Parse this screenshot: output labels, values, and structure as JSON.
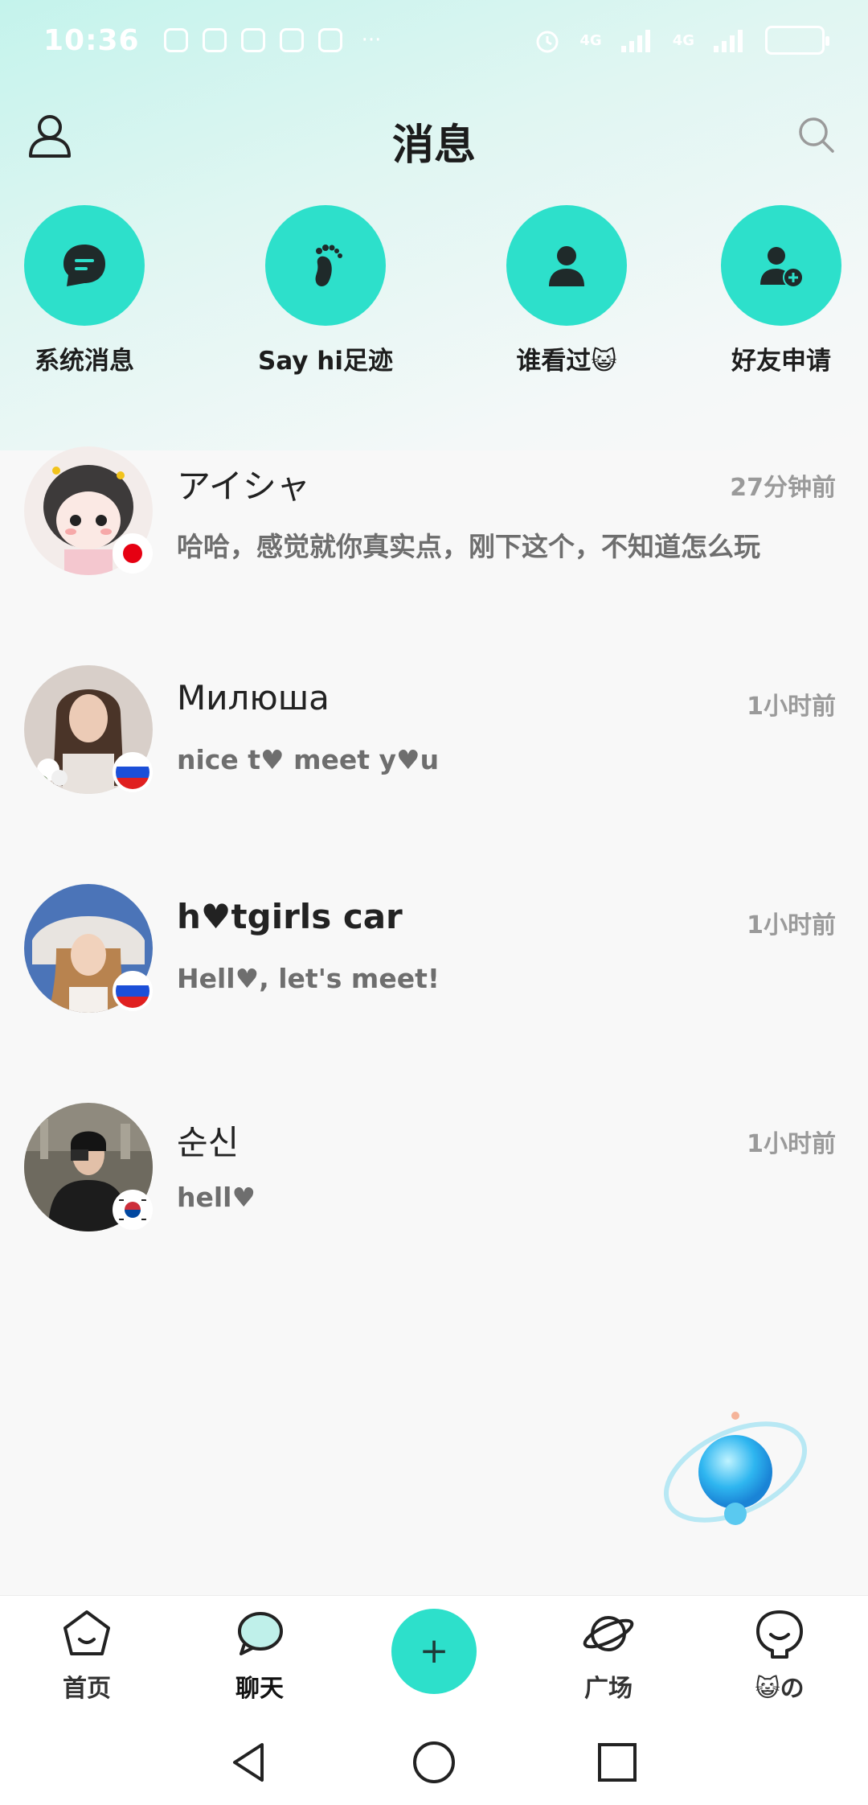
{
  "status_bar": {
    "time": "10:36",
    "more": "···",
    "signal_1": "4G",
    "signal_2": "4G"
  },
  "header": {
    "title": "消息",
    "left_icon": "user-profile-icon",
    "right_icon": "search-icon"
  },
  "quick_actions": [
    {
      "label": "系统消息",
      "icon": "chat-bubble-icon"
    },
    {
      "label": "Say hi足迹",
      "icon": "footprint-icon"
    },
    {
      "label": "谁看过😺",
      "icon": "person-icon"
    },
    {
      "label": "好友申请",
      "icon": "add-friend-icon"
    }
  ],
  "chats": [
    {
      "name": "アイシャ",
      "time": "27分钟前",
      "preview": "哈哈，感觉就你真实点，刚下这个，不知道怎么玩",
      "flag": "japan"
    },
    {
      "name": "Милюша",
      "time": "1小时前",
      "preview": "nice t♥ meet y♥u",
      "flag": "russia"
    },
    {
      "name": "h♥tgirls car",
      "time": "1小时前",
      "preview": "Hell♥, let's meet!",
      "flag": "russia"
    },
    {
      "name": "순신",
      "time": "1小时前",
      "preview": "hell♥",
      "flag": "korea"
    }
  ],
  "bottom_nav": {
    "items": [
      {
        "label": "首页",
        "icon": "home-icon"
      },
      {
        "label": "聊天",
        "icon": "chat-icon",
        "active": true
      },
      {
        "label": "广场",
        "icon": "planet-icon"
      },
      {
        "label": "😺の",
        "icon": "me-icon"
      }
    ],
    "center": "+"
  },
  "colors": {
    "accent": "#2de0cb",
    "text_dark": "#222222",
    "text_muted": "#9a9a9a"
  }
}
